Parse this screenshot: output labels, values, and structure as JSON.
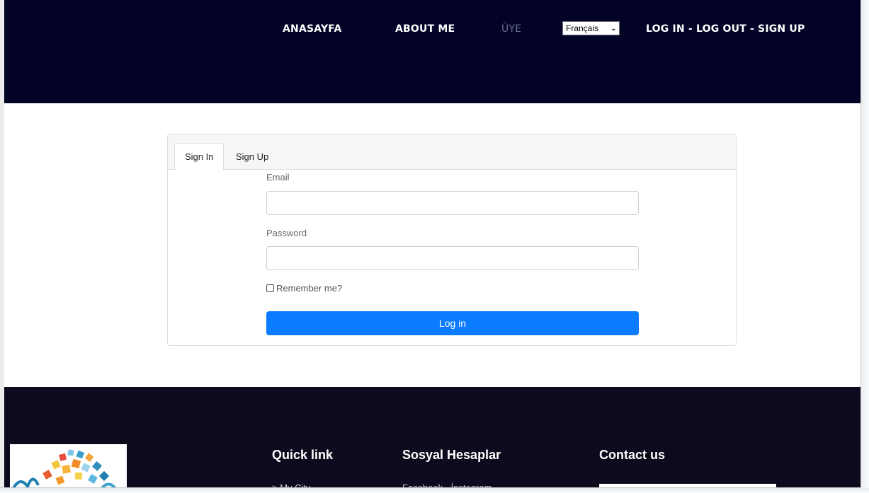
{
  "nav": {
    "home": "ANASAYFA",
    "about": "ABOUT ME",
    "member": "ÜYE",
    "language": "Français",
    "auth": "LOG IN - LOG OUT - SIGN UP"
  },
  "tabs": {
    "sign_in": "Sign In",
    "sign_up": "Sign Up"
  },
  "form": {
    "email_label": "Email",
    "email_value": "",
    "password_label": "Password",
    "password_value": "",
    "remember_label": "Remember me?",
    "remember_checked": false,
    "submit_label": "Log in"
  },
  "footer": {
    "quick_link_title": "Quick link",
    "quick_link_item": "> My City",
    "social_title": "Sosyal Hesaplar",
    "social_item": "Facebook - İnstagram",
    "contact_title": "Contact us"
  },
  "colors": {
    "header_bg": "#020327",
    "footer_bg": "#0c0a1c",
    "primary": "#0b7bff"
  }
}
